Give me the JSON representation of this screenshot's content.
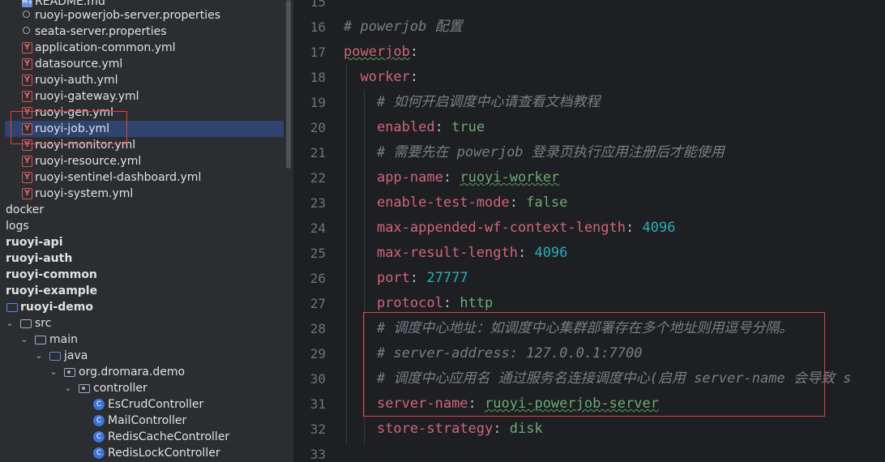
{
  "tree": {
    "items": [
      {
        "label": "README.md",
        "icon": "md"
      },
      {
        "label": "ruoyi-powerjob-server.properties",
        "icon": "gear"
      },
      {
        "label": "seata-server.properties",
        "icon": "gear"
      },
      {
        "label": "application-common.yml",
        "icon": "yml"
      },
      {
        "label": "datasource.yml",
        "icon": "yml"
      },
      {
        "label": "ruoyi-auth.yml",
        "icon": "yml"
      },
      {
        "label": "ruoyi-gateway.yml",
        "icon": "yml"
      },
      {
        "label": "ruoyi-gen.yml",
        "icon": "yml"
      },
      {
        "label": "ruoyi-job.yml",
        "icon": "yml",
        "selected": true
      },
      {
        "label": "ruoyi-monitor.yml",
        "icon": "yml"
      },
      {
        "label": "ruoyi-resource.yml",
        "icon": "yml"
      },
      {
        "label": "ruoyi-sentinel-dashboard.yml",
        "icon": "yml"
      },
      {
        "label": "ruoyi-system.yml",
        "icon": "yml"
      },
      {
        "label": "docker",
        "icon": "none"
      },
      {
        "label": "logs",
        "icon": "none"
      },
      {
        "label": "ruoyi-api",
        "icon": "none",
        "bold": true
      },
      {
        "label": "ruoyi-auth",
        "icon": "none",
        "bold": true
      },
      {
        "label": "ruoyi-common",
        "icon": "none",
        "bold": true
      },
      {
        "label": "ruoyi-example",
        "icon": "none",
        "bold": true
      },
      {
        "label": "ruoyi-demo",
        "icon": "folder-blue",
        "bold": true
      },
      {
        "label": "src",
        "icon": "folder"
      },
      {
        "label": "main",
        "icon": "folder"
      },
      {
        "label": "java",
        "icon": "folder-blue"
      },
      {
        "label": "org.dromara.demo",
        "icon": "pkg"
      },
      {
        "label": "controller",
        "icon": "pkg"
      },
      {
        "label": "EsCrudController",
        "icon": "class"
      },
      {
        "label": "MailController",
        "icon": "class"
      },
      {
        "label": "RedisCacheController",
        "icon": "class"
      },
      {
        "label": "RedisLockController",
        "icon": "class"
      }
    ]
  },
  "editor": {
    "lines": [
      {
        "n": "15",
        "text": ""
      },
      {
        "n": "16",
        "text": "# powerjob 配置"
      },
      {
        "n": "17",
        "text": "powerjob:"
      },
      {
        "n": "18",
        "text": "  worker:"
      },
      {
        "n": "19",
        "text": "    # 如何开启调度中心请查看文档教程"
      },
      {
        "n": "20",
        "text": "    enabled: true"
      },
      {
        "n": "21",
        "text": "    # 需要先在 powerjob 登录页执行应用注册后才能使用"
      },
      {
        "n": "22",
        "text": "    app-name: ruoyi-worker"
      },
      {
        "n": "23",
        "text": "    enable-test-mode: false"
      },
      {
        "n": "24",
        "text": "    max-appended-wf-context-length: 4096"
      },
      {
        "n": "25",
        "text": "    max-result-length: 4096"
      },
      {
        "n": "26",
        "text": "    port: 27777"
      },
      {
        "n": "27",
        "text": "    protocol: http"
      },
      {
        "n": "28",
        "text": "    # 调度中心地址：如调度中心集群部署存在多个地址则用逗号分隔。"
      },
      {
        "n": "29",
        "text": "    # server-address: 127.0.0.1:7700"
      },
      {
        "n": "30",
        "text": "    # 调度中心应用名 通过服务名连接调度中心(启用 server-name 会导致 s"
      },
      {
        "n": "31",
        "text": "    server-name: ruoyi-powerjob-server"
      },
      {
        "n": "32",
        "text": "    store-strategy: disk"
      },
      {
        "n": "33",
        "text": ""
      }
    ]
  },
  "colors": {
    "key": "#cf6679",
    "value": "#6aab73",
    "number": "#2aacb8",
    "comment": "#7a7e85",
    "highlight": "#e0433f",
    "selection": "#2e436e"
  }
}
